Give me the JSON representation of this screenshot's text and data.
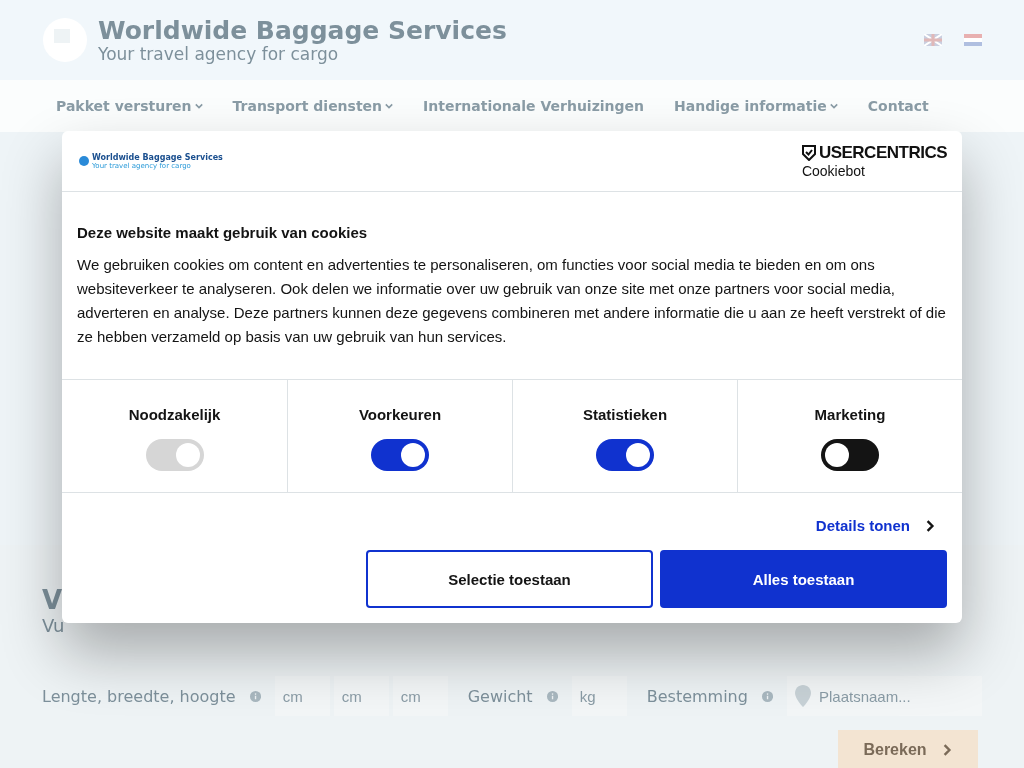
{
  "site": {
    "brand": "Worldwide Baggage Services",
    "tagline": "Your travel agency for cargo",
    "nav": [
      {
        "label": "Pakket versturen",
        "dropdown": true
      },
      {
        "label": "Transport diensten",
        "dropdown": true
      },
      {
        "label": "Internationale Verhuizingen",
        "dropdown": false
      },
      {
        "label": "Handige informatie",
        "dropdown": true
      },
      {
        "label": "Contact",
        "dropdown": false
      }
    ],
    "hero": {
      "title": "V",
      "subtitle": "Vu"
    },
    "calculator": {
      "size_label": "Lengte, breedte, hoogte",
      "size_fields": [
        {
          "placeholder": "cm"
        },
        {
          "placeholder": "cm"
        },
        {
          "placeholder": "cm"
        }
      ],
      "weight_label": "Gewicht",
      "weight_field": {
        "placeholder": "kg"
      },
      "destination_label": "Bestemming",
      "destination_field": {
        "placeholder": "Plaatsnaam..."
      },
      "submit": "Bereken"
    }
  },
  "dialog": {
    "logo_brand": "Worldwide Baggage Services",
    "logo_tagline": "Your travel agency for cargo",
    "provider": "USERCENTRICS",
    "provider_product": "Cookiebot",
    "title": "Deze website maakt gebruik van cookies",
    "body": "We gebruiken cookies om content en advertenties te personaliseren, om functies voor social media te bieden en om ons websiteverkeer te analyseren. Ook delen we informatie over uw gebruik van onze site met onze partners voor social media, adverteren en analyse. Deze partners kunnen deze gegevens combineren met andere informatie die u aan ze heeft verstrekt of die ze hebben verzameld op basis van uw gebruik van hun services.",
    "categories": [
      {
        "label": "Noodzakelijk",
        "on": true,
        "disabled": true
      },
      {
        "label": "Voorkeuren",
        "on": true,
        "disabled": false
      },
      {
        "label": "Statistieken",
        "on": true,
        "disabled": false
      },
      {
        "label": "Marketing",
        "on": false,
        "disabled": false
      }
    ],
    "details_link": "Details tonen",
    "buttons": [
      {
        "label": "Selectie toestaan",
        "kind": "outline"
      },
      {
        "label": "Alles toestaan",
        "kind": "primary"
      }
    ]
  }
}
